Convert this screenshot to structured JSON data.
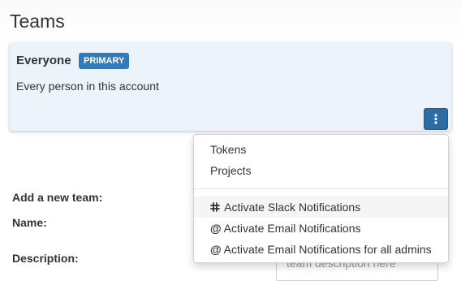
{
  "page": {
    "title": "Teams"
  },
  "team": {
    "name": "Everyone",
    "badge": "PRIMARY",
    "description": "Every person in this account"
  },
  "form": {
    "add_label": "Add a new team:",
    "name_label": "Name:",
    "description_label": "Description:",
    "description_placeholder": "team description here"
  },
  "menu": {
    "items": [
      {
        "label": "Tokens",
        "icon": null
      },
      {
        "label": "Projects",
        "icon": null
      },
      {
        "label": "Activate Slack Notifications",
        "icon": "slack-icon"
      },
      {
        "label": "Activate Email Notifications",
        "icon": "at-icon"
      },
      {
        "label": "Activate Email Notifications for all admins",
        "icon": "at-icon"
      }
    ]
  },
  "colors": {
    "badge": "#337ab7",
    "menu_button": "#2d6da3",
    "card_background": "#edf3fa"
  }
}
